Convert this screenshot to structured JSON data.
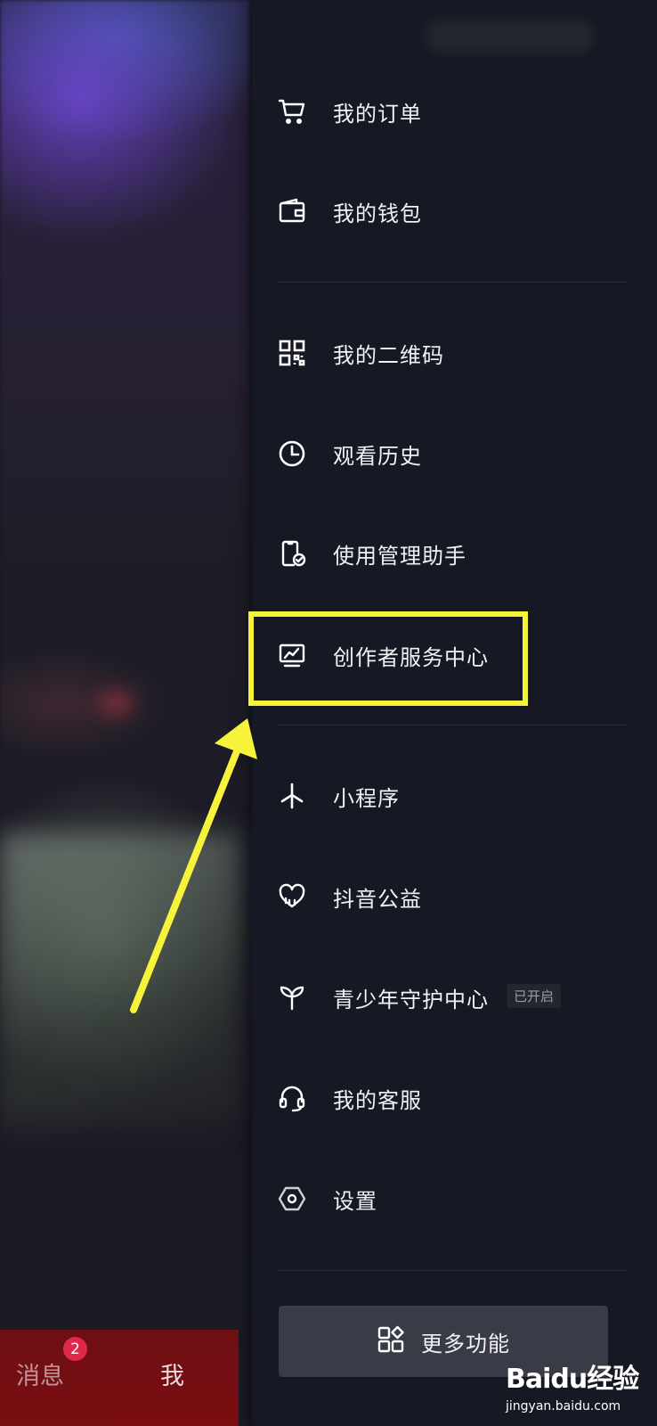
{
  "menu": {
    "items": [
      {
        "label": "我的订单",
        "icon": "cart-icon"
      },
      {
        "label": "我的钱包",
        "icon": "wallet-icon"
      },
      {
        "label": "我的二维码",
        "icon": "qrcode-icon"
      },
      {
        "label": "观看历史",
        "icon": "clock-icon"
      },
      {
        "label": "使用管理助手",
        "icon": "phone-check-icon"
      },
      {
        "label": "创作者服务中心",
        "icon": "monitor-chart-icon"
      },
      {
        "label": "小程序",
        "icon": "miniapp-icon"
      },
      {
        "label": "抖音公益",
        "icon": "heart-charity-icon"
      },
      {
        "label": "青少年守护中心",
        "icon": "sprout-icon",
        "badge": "已开启"
      },
      {
        "label": "我的客服",
        "icon": "headset-icon"
      },
      {
        "label": "设置",
        "icon": "settings-icon"
      }
    ],
    "more_button": {
      "label": "更多功能",
      "icon": "grid-icon"
    }
  },
  "bottom_nav": {
    "messages_label": "消息",
    "messages_badge": "2",
    "me_label": "我"
  },
  "watermark": {
    "logo_text": "Baidu经验",
    "url": "jingyan.baidu.com"
  },
  "colors": {
    "panel_bg": "#161823",
    "highlight": "#f7f23a",
    "badge": "#e0284a"
  }
}
